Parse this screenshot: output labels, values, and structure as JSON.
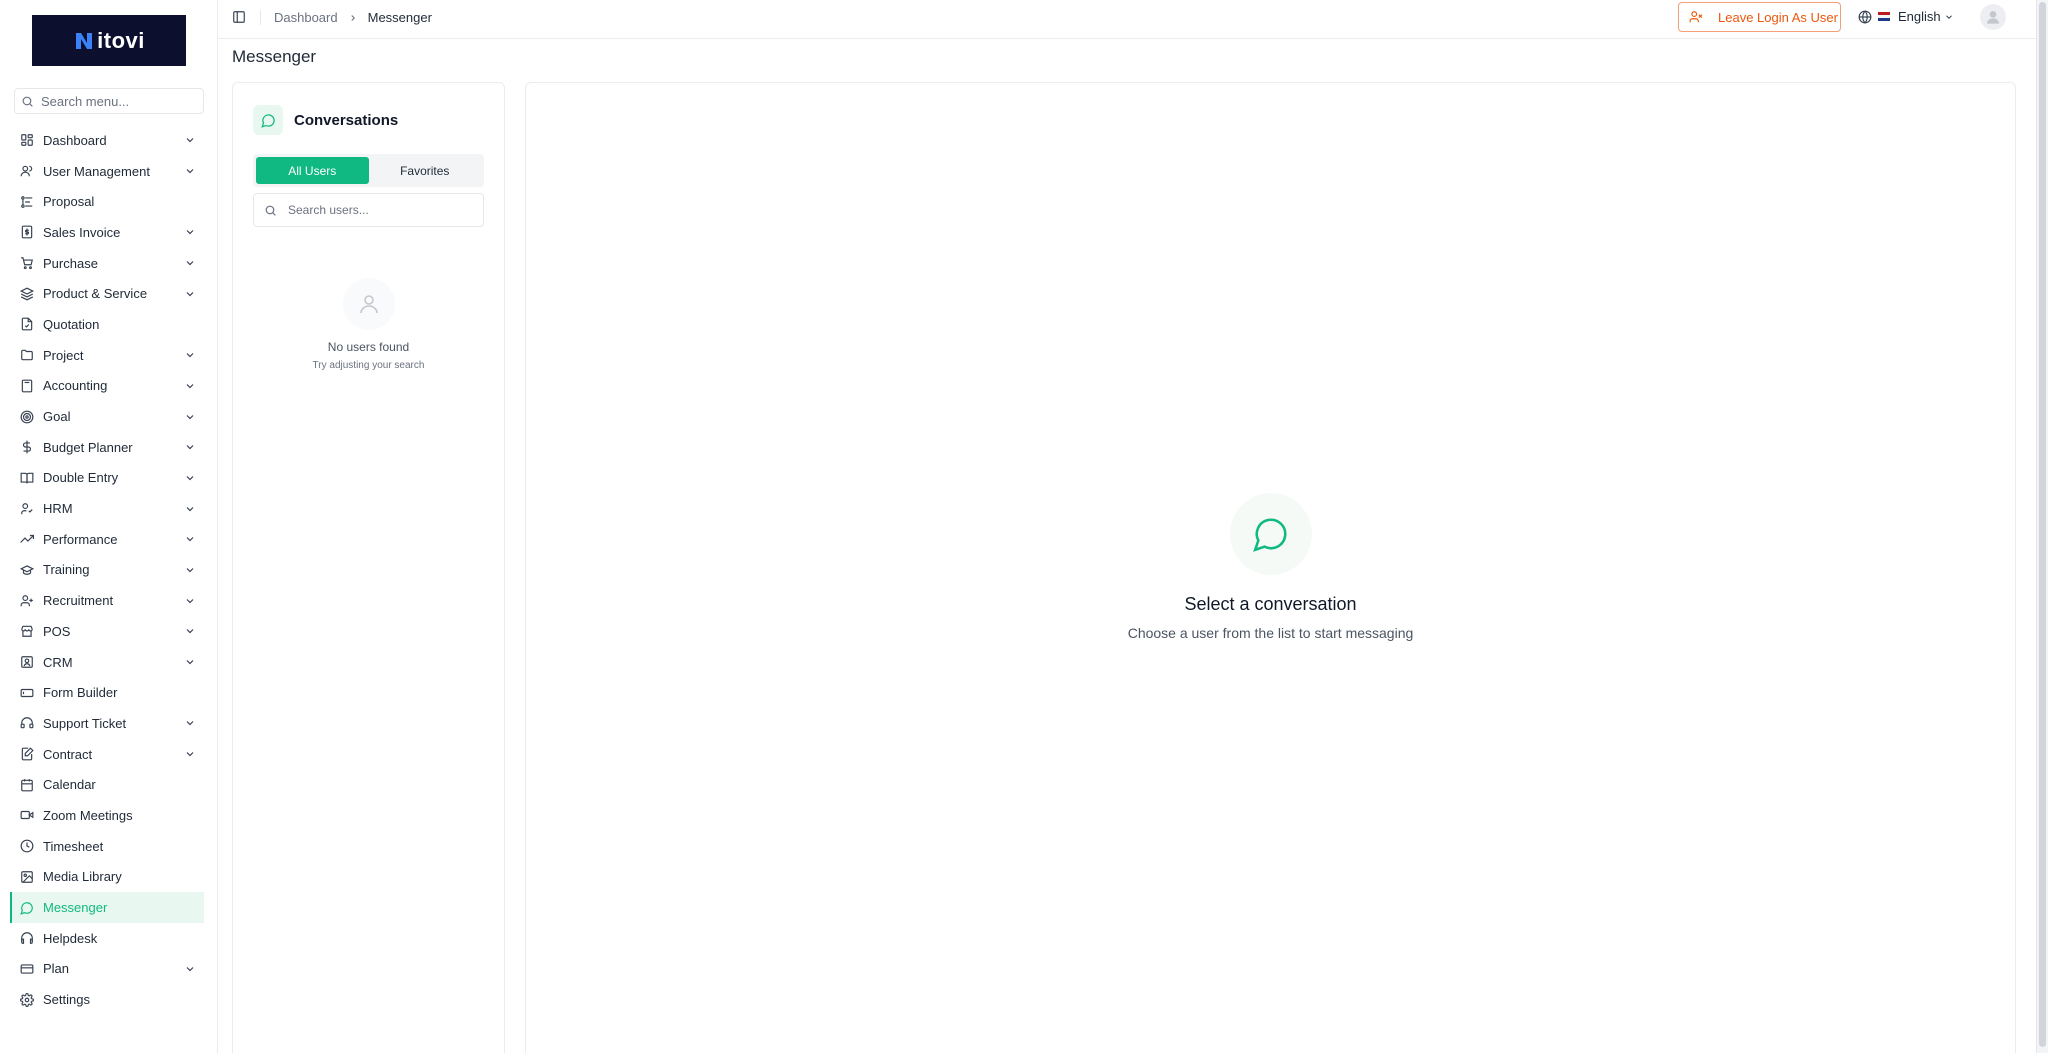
{
  "brand": {
    "logo_text": "itovi",
    "logo_initial": "N"
  },
  "sidebar": {
    "search_placeholder": "Search menu...",
    "items": [
      {
        "label": "Dashboard",
        "icon": "dashboard-grid-icon",
        "expandable": true
      },
      {
        "label": "User Management",
        "icon": "user-icon",
        "expandable": true
      },
      {
        "label": "Proposal",
        "icon": "proposal-icon",
        "expandable": false
      },
      {
        "label": "Sales Invoice",
        "icon": "invoice-icon",
        "expandable": true
      },
      {
        "label": "Purchase",
        "icon": "cart-icon",
        "expandable": true
      },
      {
        "label": "Product & Service",
        "icon": "layers-icon",
        "expandable": true
      },
      {
        "label": "Quotation",
        "icon": "quotation-icon",
        "expandable": false
      },
      {
        "label": "Project",
        "icon": "folder-icon",
        "expandable": true
      },
      {
        "label": "Accounting",
        "icon": "calculator-icon",
        "expandable": true
      },
      {
        "label": "Goal",
        "icon": "target-icon",
        "expandable": true
      },
      {
        "label": "Budget Planner",
        "icon": "dollar-icon",
        "expandable": true
      },
      {
        "label": "Double Entry",
        "icon": "book-icon",
        "expandable": true
      },
      {
        "label": "HRM",
        "icon": "users-icon",
        "expandable": true
      },
      {
        "label": "Performance",
        "icon": "trending-up-icon",
        "expandable": true
      },
      {
        "label": "Training",
        "icon": "graduation-cap-icon",
        "expandable": true
      },
      {
        "label": "Recruitment",
        "icon": "user-plus-icon",
        "expandable": true
      },
      {
        "label": "POS",
        "icon": "store-icon",
        "expandable": true
      },
      {
        "label": "CRM",
        "icon": "contact-icon",
        "expandable": true
      },
      {
        "label": "Form Builder",
        "icon": "form-icon",
        "expandable": false
      },
      {
        "label": "Support Ticket",
        "icon": "headset-icon",
        "expandable": true
      },
      {
        "label": "Contract",
        "icon": "contract-icon",
        "expandable": true
      },
      {
        "label": "Calendar",
        "icon": "calendar-icon",
        "expandable": false
      },
      {
        "label": "Zoom Meetings",
        "icon": "video-icon",
        "expandable": false
      },
      {
        "label": "Timesheet",
        "icon": "clock-icon",
        "expandable": false
      },
      {
        "label": "Media Library",
        "icon": "image-icon",
        "expandable": false
      },
      {
        "label": "Messenger",
        "icon": "message-icon",
        "expandable": false,
        "active": true
      },
      {
        "label": "Helpdesk",
        "icon": "headphones-icon",
        "expandable": false
      },
      {
        "label": "Plan",
        "icon": "credit-card-icon",
        "expandable": true
      },
      {
        "label": "Settings",
        "icon": "gear-icon",
        "expandable": false
      }
    ]
  },
  "header": {
    "breadcrumb": [
      "Dashboard",
      "Messenger"
    ],
    "leave_button": "Leave Login As User",
    "language": "English"
  },
  "page": {
    "title": "Messenger"
  },
  "conversations": {
    "title": "Conversations",
    "tabs": [
      {
        "label": "All Users",
        "active": true
      },
      {
        "label": "Favorites",
        "active": false
      }
    ],
    "search_placeholder": "Search users...",
    "empty_title": "No users found",
    "empty_subtitle": "Try adjusting your search"
  },
  "chat": {
    "empty_title": "Select a conversation",
    "empty_subtitle": "Choose a user from the list to start messaging"
  },
  "colors": {
    "accent": "#10b981",
    "accent_light": "#e8f7ef",
    "warning": "#ea580c",
    "logo_bg": "#0c0f2e"
  }
}
